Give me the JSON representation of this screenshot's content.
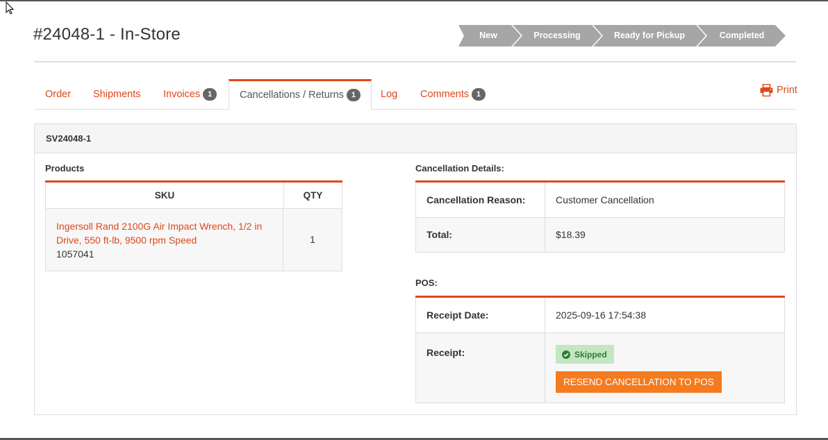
{
  "page": {
    "title": "#24048-1 - In-Store"
  },
  "status_steps": [
    "New",
    "Processing",
    "Ready for Pickup",
    "Completed"
  ],
  "tabs": [
    {
      "label": "Order"
    },
    {
      "label": "Shipments"
    },
    {
      "label": "Invoices",
      "badge": "1"
    },
    {
      "label": "Cancellations / Returns",
      "badge": "1",
      "active": true
    },
    {
      "label": "Log"
    },
    {
      "label": "Comments",
      "badge": "1"
    }
  ],
  "print_label": "Print",
  "panel": {
    "title": "SV24048-1",
    "products": {
      "label": "Products",
      "headers": {
        "sku": "SKU",
        "qty": "QTY"
      },
      "rows": [
        {
          "name_line1": "Ingersoll Rand 2100G Air Impact Wrench, 1/2 in",
          "name_line2": "Drive, 550 ft-lb, 9500 rpm Speed",
          "sku": "1057041",
          "qty": "1"
        }
      ]
    },
    "cancellation": {
      "label": "Cancellation Details:",
      "reason_label": "Cancellation Reason:",
      "reason_value": "Customer Cancellation",
      "total_label": "Total:",
      "total_value": "$18.39"
    },
    "pos": {
      "label": "POS:",
      "receipt_date_label": "Receipt Date:",
      "receipt_date_value": "2025-09-16 17:54:38",
      "receipt_label": "Receipt:",
      "status_badge": "Skipped",
      "resend_button": "RESEND CANCELLATION TO POS"
    }
  },
  "colors": {
    "accent": "#e0461a",
    "step_bg": "#a6a6a6",
    "button": "#f47b20",
    "success_bg": "#c3e6c3"
  }
}
